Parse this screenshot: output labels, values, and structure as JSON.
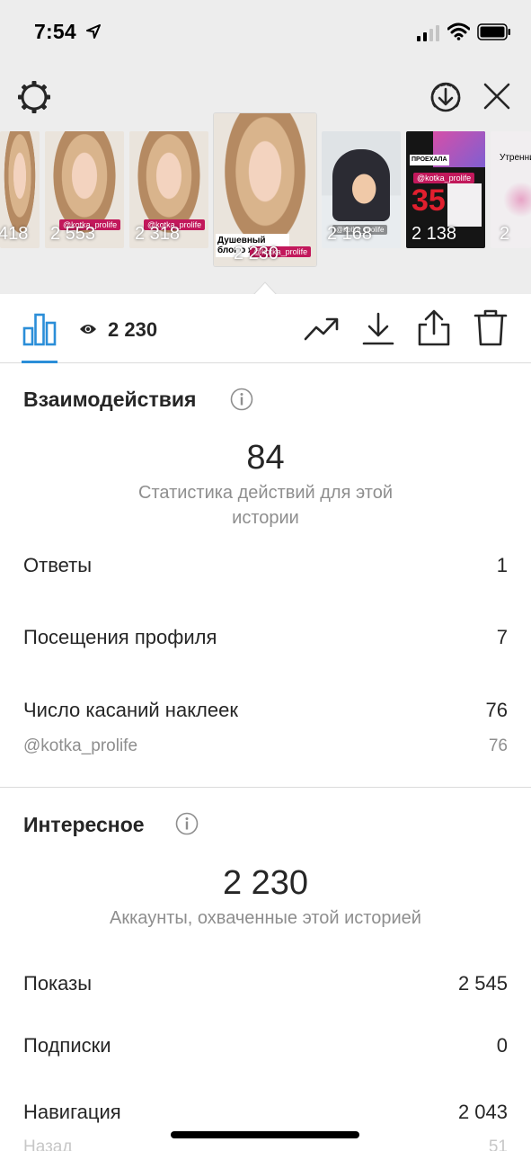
{
  "status_bar": {
    "time": "7:54"
  },
  "stories": [
    {
      "views": "418"
    },
    {
      "views": "2 553",
      "tag": "@kotka_prolife"
    },
    {
      "views": "2 318",
      "tag": "@kotka_prolife"
    },
    {
      "views": "2 230",
      "caption": "Душевный блог о жизни",
      "tag": "@kotka_prolife"
    },
    {
      "views": "2 168",
      "tag": "@kotka_prolife"
    },
    {
      "views": "2 138",
      "tag": "@kotka_prolife",
      "caption": "ПРОЕХАЛА",
      "sticker": "35"
    },
    {
      "views": "2",
      "caption": "Утренни"
    }
  ],
  "toolbar": {
    "views_total": "2 230"
  },
  "interactions": {
    "title": "Взаимодействия",
    "total": "84",
    "subtitle": "Статистика действий для этой истории",
    "rows": [
      {
        "label": "Ответы",
        "value": "1"
      },
      {
        "label": "Посещения профиля",
        "value": "7"
      },
      {
        "label": "Число касаний наклеек",
        "value": "76"
      }
    ],
    "sticker_sub": {
      "label": "@kotka_prolife",
      "value": "76"
    }
  },
  "discovery": {
    "title": "Интересное",
    "total": "2 230",
    "subtitle": "Аккаунты, охваченные этой историей",
    "rows": [
      {
        "label": "Показы",
        "value": "2 545"
      },
      {
        "label": "Подписки",
        "value": "0"
      },
      {
        "label": "Навигация",
        "value": "2 043"
      }
    ],
    "nav_sub": {
      "label": "Назад",
      "value": "51"
    }
  },
  "colors": {
    "accent_blue": "#2b8ed8",
    "brand_tag": "#c2185b",
    "top_background": "#ededed"
  },
  "icons": [
    "settings-icon",
    "download-circle-icon",
    "close-icon",
    "insights-icon",
    "eye-icon",
    "trend-icon",
    "download-icon",
    "share-icon",
    "trash-icon",
    "info-icon"
  ]
}
